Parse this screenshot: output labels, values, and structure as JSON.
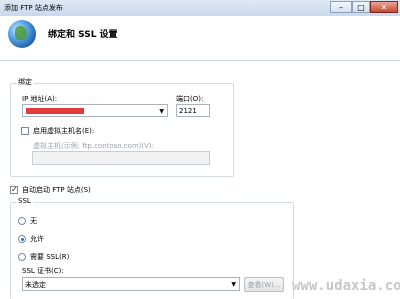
{
  "window": {
    "title": "添加 FTP 站点发布",
    "controls": {
      "minimize": "–",
      "maximize": "□",
      "close": "✕"
    }
  },
  "header": {
    "title": "绑定和 SSL 设置",
    "icon": "globe-icon"
  },
  "binding": {
    "legend": "绑定",
    "ip_label": "IP 地址(A):",
    "ip_value": "",
    "port_label": "端口(O):",
    "port_value": "2121",
    "virtual_host_checkbox": {
      "label": "启用虚拟主机名(E):",
      "checked": false
    },
    "virtual_host_label": "虚拟主机(示例: ftp.contoso.com)(V):",
    "virtual_host_value": ""
  },
  "autostart": {
    "label": "自动启动 FTP 站点(S)",
    "checked": true
  },
  "ssl": {
    "legend": "SSL",
    "options": [
      {
        "label": "无",
        "selected": false
      },
      {
        "label": "允许",
        "selected": true
      },
      {
        "label": "需要 SSL(R)",
        "selected": false
      }
    ],
    "cert_label": "SSL 证书(C):",
    "cert_value": "未选定",
    "view_button": "查看(W)..."
  },
  "watermark": "www.udaxia.com",
  "colors": {
    "accent": "#2b6cc4",
    "redaction": "#e23b3b"
  }
}
